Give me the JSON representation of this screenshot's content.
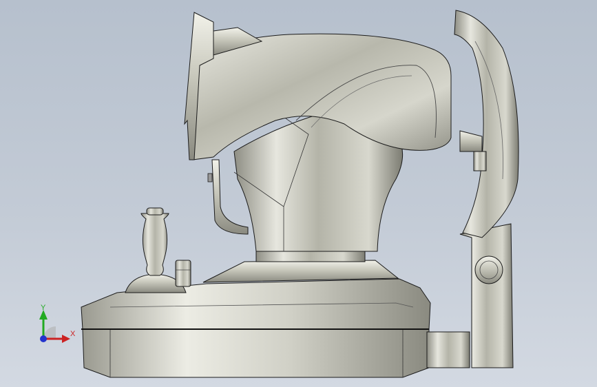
{
  "viewport": {
    "background_top": "#b6c0cd",
    "background_bottom": "#d3d9e2",
    "model_color": "#c8c8bc",
    "model_edge_color": "#1a1a1a"
  },
  "triad": {
    "x_label": "X",
    "y_label": "Y",
    "x_color": "#cc2222",
    "y_color": "#22aa22",
    "z_color": "#2233cc"
  }
}
